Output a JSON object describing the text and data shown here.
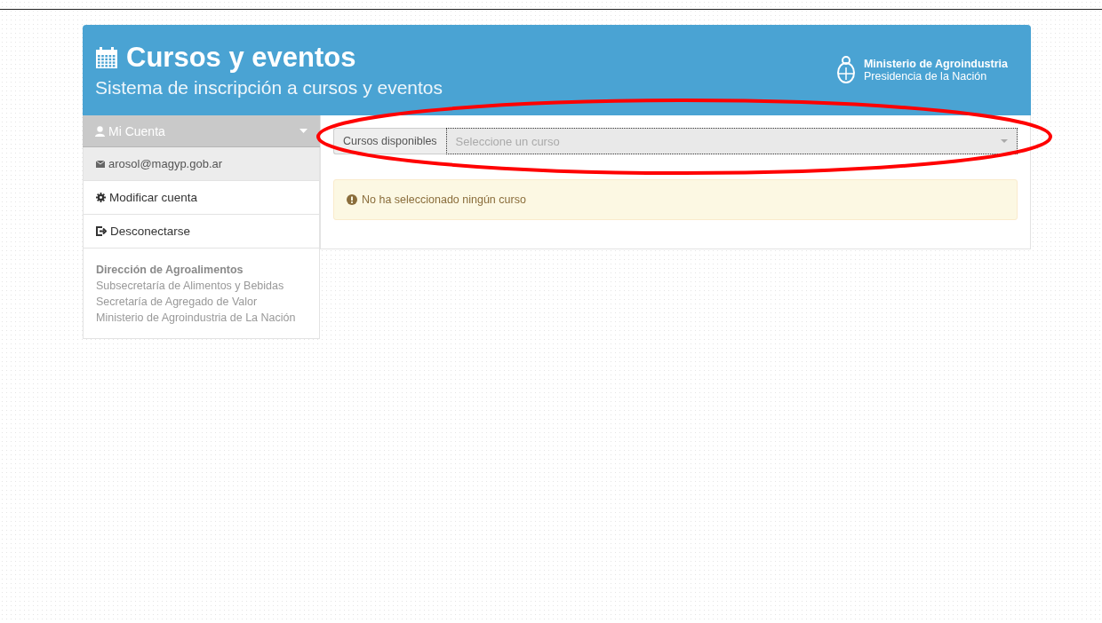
{
  "header": {
    "title": "Cursos y eventos",
    "subtitle": "Sistema de inscripción a cursos y eventos",
    "ministry": "Ministerio de Agroindustria",
    "presidency": "Presidencia de la Nación"
  },
  "sidebar": {
    "account": "Mi Cuenta",
    "items": [
      {
        "kind": "email",
        "label": "arosol@magyp.gob.ar"
      },
      {
        "kind": "settings",
        "label": "Modificar cuenta"
      },
      {
        "kind": "logout",
        "label": "Desconectarse"
      }
    ],
    "footer": {
      "heading": "Dirección de Agroalimentos",
      "lines": [
        "Subsecretaría de Alimentos y Bebidas",
        "Secretaría de Agregado de Valor",
        "Ministerio de Agroindustria de La Nación"
      ]
    }
  },
  "course_select": {
    "label": "Cursos disponibles",
    "placeholder": "Seleccione un curso"
  },
  "alert": {
    "text": "No ha seleccionado ningún curso"
  }
}
